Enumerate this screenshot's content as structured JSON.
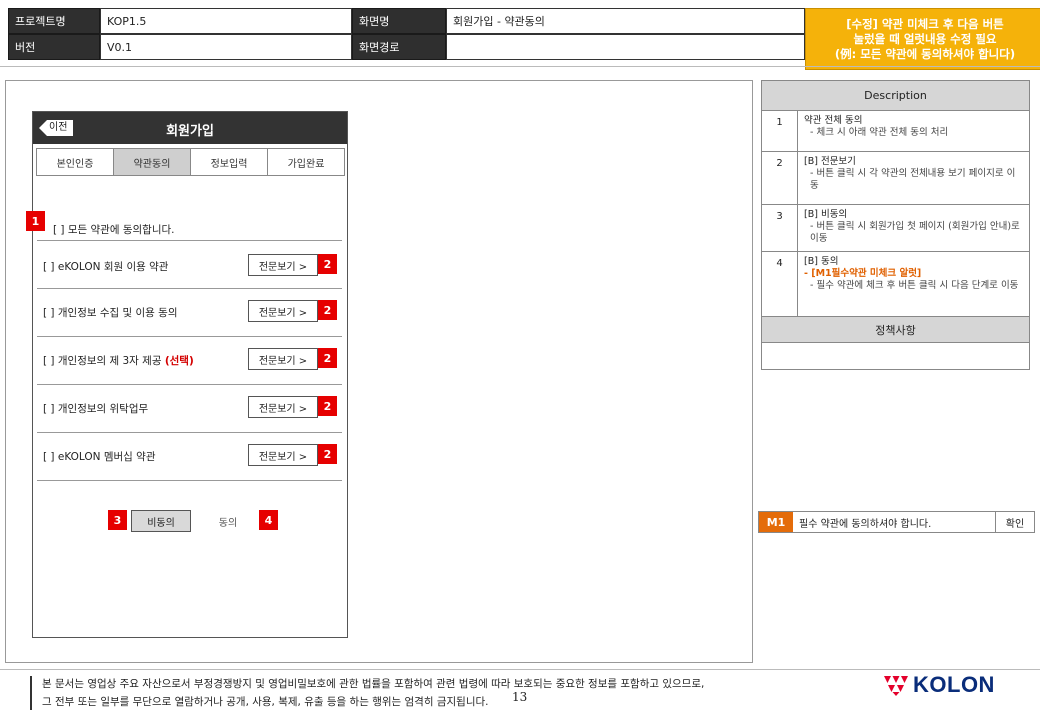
{
  "header": {
    "project_label": "프로젝트명",
    "project_value": "KOP1.5",
    "version_label": "버전",
    "version_value": "V0.1",
    "screen_label": "화면명",
    "screen_value": "회원가입 - 약관동의",
    "path_label": "화면경로",
    "path_value": ""
  },
  "notice": {
    "line1": "[수정] 약관 미체크 후 다음 버튼",
    "line2": "눌렀을 때 얼럿내용 수정 필요",
    "line3": "(例: 모든 약관에 동의하셔야 합니다)"
  },
  "phone": {
    "back_label": "이전",
    "title": "회원가입",
    "steps": [
      "본인인증",
      "약관동의",
      "정보입력",
      "가입완료"
    ],
    "agree_all": "[ ] 모든 약관에 동의합니다.",
    "terms": [
      {
        "label": "[ ] eKOLON 회원 이용 약관",
        "opt": "",
        "btn": "전문보기 >"
      },
      {
        "label": "[ ] 개인정보 수집 및 이용 동의",
        "opt": "",
        "btn": "전문보기 >"
      },
      {
        "label": "[ ] 개인정보의 제 3자 제공 ",
        "opt": "(선택)",
        "btn": "전문보기 >"
      },
      {
        "label": "[ ] 개인정보의 위탁업무",
        "opt": "",
        "btn": "전문보기 >"
      },
      {
        "label": "[ ] eKOLON 멤버십 약관",
        "opt": "",
        "btn": "전문보기 >"
      }
    ],
    "disagree_label": "비동의",
    "agree_label": "동의"
  },
  "badges": {
    "b1": "1",
    "b2": "2",
    "b3": "3",
    "b4": "4"
  },
  "description": {
    "head": "Description",
    "rows": [
      {
        "num": "1",
        "title": "약관 전체 동의",
        "lines": [
          "- 체크 시 아래 약관 전체 동의 처리"
        ],
        "warn": ""
      },
      {
        "num": "2",
        "title": "[B] 전문보기",
        "lines": [
          "- 버튼 클릭 시 각 약관의 전체내용 보기 페이지로 이동"
        ],
        "warn": ""
      },
      {
        "num": "3",
        "title": "[B] 비동의",
        "lines": [
          "- 버튼 클릭 시 회원가입 첫 페이지 (회원가입 안내)로 이동"
        ],
        "warn": ""
      },
      {
        "num": "4",
        "title": "[B] 동의",
        "lines": [
          "- 필수 약관에 체크 후 버튼 클릭 시 다음 단계로 이동"
        ],
        "warn": "- [M1필수약관 미체크 알럿]"
      }
    ],
    "sub_head": "정책사항"
  },
  "m1": {
    "tag": "M1",
    "message": "필수 약관에 동의하셔야 합니다.",
    "button": "확인"
  },
  "footer": {
    "line1": "본 문서는 영업상 주요 자산으로서 부정경쟁방지 및 영업비밀보호에 관한 법률을 포함하여 관련 법령에 따라 보호되는 중요한 정보를 포함하고 있으므로,",
    "line2": "그 전부 또는 일부를 무단으로 열람하거나 공개, 사용, 복제, 유출 등을 하는 행위는 엄격히 금지됩니다.",
    "page": "13",
    "logo_text": "KOLON"
  },
  "colors": {
    "badge": "#e60000",
    "notice": "#f5b20a",
    "m1": "#e46c0a",
    "header_label": "#2f2f2f",
    "logo": "#0a2d7a",
    "logo_mark": "#e4002b"
  }
}
